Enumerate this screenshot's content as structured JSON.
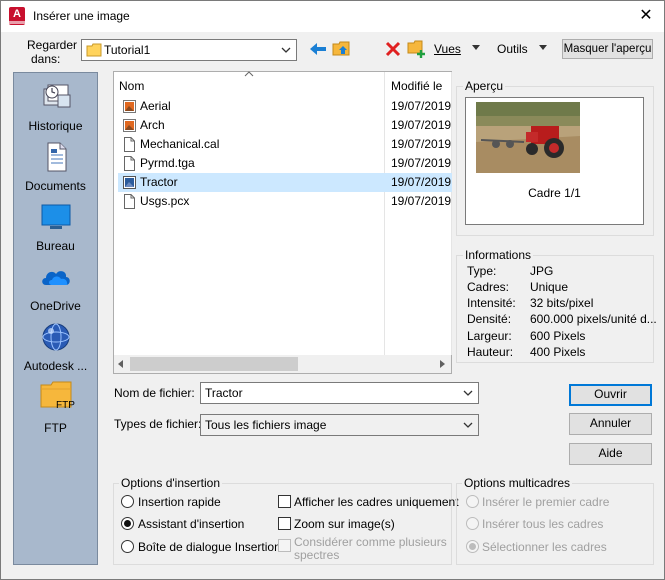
{
  "window": {
    "title": "Insérer une image",
    "close_glyph": "✕",
    "app_icon_letter": "A"
  },
  "toolbar": {
    "look_in_label_line1": "Regarder",
    "look_in_label_line2": "dans:",
    "look_in_value": "Tutorial1",
    "views_label": "Vues",
    "tools_label": "Outils",
    "hide_preview_label": "Masquer l'aperçu"
  },
  "places": [
    {
      "label": "Historique",
      "icon": "history-icon"
    },
    {
      "label": "Documents",
      "icon": "documents-icon"
    },
    {
      "label": "Bureau",
      "icon": "desktop-icon"
    },
    {
      "label": "OneDrive",
      "icon": "onedrive-icon"
    },
    {
      "label": "Autodesk ...",
      "icon": "autodesk-icon"
    },
    {
      "label": "FTP",
      "icon": "ftp-folder-icon",
      "sublabel": "FTP"
    }
  ],
  "filelist": {
    "col_name": "Nom",
    "col_modified": "Modifié le",
    "files": [
      {
        "name": "Aerial",
        "date": "19/07/2019",
        "icon": "image-file-icon"
      },
      {
        "name": "Arch",
        "date": "19/07/2019",
        "icon": "image-file-icon"
      },
      {
        "name": "Mechanical.cal",
        "date": "19/07/2019",
        "icon": "file-icon"
      },
      {
        "name": "Pyrmd.tga",
        "date": "19/07/2019",
        "icon": "file-icon"
      },
      {
        "name": "Tractor",
        "date": "19/07/2019",
        "icon": "image-file-icon",
        "selected": true
      },
      {
        "name": "Usgs.pcx",
        "date": "19/07/2019",
        "icon": "file-icon"
      }
    ]
  },
  "preview": {
    "group_label": "Aperçu",
    "caption": "Cadre 1/1"
  },
  "info": {
    "group_label": "Informations",
    "rows": [
      {
        "key": "Type:",
        "value": "JPG"
      },
      {
        "key": "Cadres:",
        "value": "Unique"
      },
      {
        "key": "Intensité:",
        "value": "32 bits/pixel"
      },
      {
        "key": "Densité:",
        "value": "600.000 pixels/unité d..."
      },
      {
        "key": "Largeur:",
        "value": "600 Pixels"
      },
      {
        "key": "Hauteur:",
        "value": "400 Pixels"
      }
    ]
  },
  "filename": {
    "label": "Nom de fichier:",
    "value": "Tractor"
  },
  "filetype": {
    "label": "Types de fichier:",
    "value": "Tous les fichiers image"
  },
  "buttons": {
    "open": "Ouvrir",
    "cancel": "Annuler",
    "help": "Aide"
  },
  "insert_options": {
    "group_label": "Options d'insertion",
    "quick": "Insertion rapide",
    "wizard": "Assistant d'insertion",
    "dialog": "Boîte de dialogue Insertion",
    "show_frames_only": "Afficher les cadres uniquement",
    "zoom_to_image": "Zoom sur image(s)",
    "multiple_frames_line1": "Considérer comme plusieurs",
    "multiple_frames_line2": "spectres"
  },
  "multiframe_options": {
    "group_label": "Options multicadres",
    "first_frame": "Insérer le premier cadre",
    "all_frames": "Insérer tous les cadres",
    "select_frames": "Sélectionner les cadres"
  },
  "colors": {
    "accent": "#0078d7",
    "selection": "#cce8ff",
    "places_bg": "#a8b8cc",
    "brand_red": "#c8102e"
  }
}
